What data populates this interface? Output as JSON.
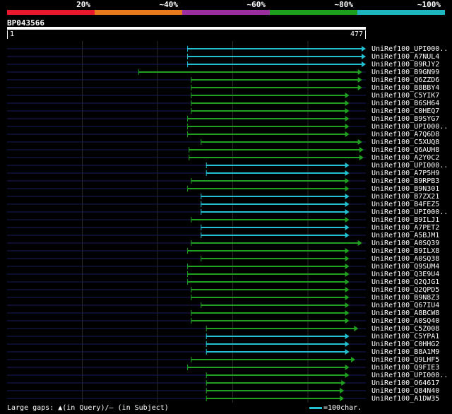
{
  "scale": {
    "segments": [
      {
        "label": "20%",
        "color": "#e8192c"
      },
      {
        "label": "~40%",
        "color": "#e87a1e"
      },
      {
        "label": "~60%",
        "color": "#9c2fa0"
      },
      {
        "label": "~80%",
        "color": "#1ea01e"
      },
      {
        "label": "~100%",
        "color": "#1eb4c0"
      }
    ]
  },
  "query": {
    "name": "BP043566",
    "start": "1",
    "end": "477",
    "length": 477
  },
  "colors": {
    "cyan": "#22c0d0",
    "green": "#20a020",
    "navy": "#1a1a60",
    "grid": "#2a2a2a"
  },
  "hits": [
    {
      "name": "UniRef100_UPI000..",
      "start": 240,
      "end": 477,
      "color": "cyan"
    },
    {
      "name": "UniRef100_A7NUL4",
      "start": 240,
      "end": 477,
      "color": "cyan"
    },
    {
      "name": "UniRef100_B9RJY2",
      "start": 240,
      "end": 477,
      "color": "cyan"
    },
    {
      "name": "UniRef100_B9GN99",
      "start": 175,
      "end": 472,
      "color": "green"
    },
    {
      "name": "UniRef100_Q6ZZD6",
      "start": 245,
      "end": 472,
      "color": "green"
    },
    {
      "name": "UniRef100_B8BBY4",
      "start": 245,
      "end": 472,
      "color": "green"
    },
    {
      "name": "UniRef100_C5YIK7",
      "start": 245,
      "end": 455,
      "color": "green"
    },
    {
      "name": "UniRef100_B6SH64",
      "start": 245,
      "end": 455,
      "color": "green"
    },
    {
      "name": "UniRef100_C0HEQ7",
      "start": 245,
      "end": 455,
      "color": "green"
    },
    {
      "name": "UniRef100_B9SYG7",
      "start": 240,
      "end": 455,
      "color": "green"
    },
    {
      "name": "UniRef100_UPI000..",
      "start": 240,
      "end": 455,
      "color": "green"
    },
    {
      "name": "UniRef100_A7Q6D8",
      "start": 240,
      "end": 455,
      "color": "green"
    },
    {
      "name": "UniRef100_C5XUQ8",
      "start": 258,
      "end": 472,
      "color": "green"
    },
    {
      "name": "UniRef100_Q6AUH8",
      "start": 242,
      "end": 474,
      "color": "green"
    },
    {
      "name": "UniRef100_A2Y0C2",
      "start": 242,
      "end": 474,
      "color": "green"
    },
    {
      "name": "UniRef100_UPI000..",
      "start": 265,
      "end": 455,
      "color": "cyan"
    },
    {
      "name": "UniRef100_A7P5H9",
      "start": 265,
      "end": 455,
      "color": "cyan"
    },
    {
      "name": "UniRef100_B9RPB3",
      "start": 245,
      "end": 455,
      "color": "green"
    },
    {
      "name": "UniRef100_B9N301",
      "start": 240,
      "end": 455,
      "color": "green"
    },
    {
      "name": "UniRef100_B7ZX21",
      "start": 258,
      "end": 455,
      "color": "cyan"
    },
    {
      "name": "UniRef100_B4FEZ5",
      "start": 258,
      "end": 455,
      "color": "cyan"
    },
    {
      "name": "UniRef100_UPI000..",
      "start": 258,
      "end": 455,
      "color": "cyan"
    },
    {
      "name": "UniRef100_B9ILJ1",
      "start": 245,
      "end": 455,
      "color": "green"
    },
    {
      "name": "UniRef100_A7PET2",
      "start": 258,
      "end": 455,
      "color": "cyan"
    },
    {
      "name": "UniRef100_A5BJM1",
      "start": 258,
      "end": 455,
      "color": "cyan"
    },
    {
      "name": "UniRef100_A0SQ39",
      "start": 245,
      "end": 472,
      "color": "green"
    },
    {
      "name": "UniRef100_B9ILX8",
      "start": 240,
      "end": 455,
      "color": "green"
    },
    {
      "name": "UniRef100_A0SQ38",
      "start": 258,
      "end": 455,
      "color": "green"
    },
    {
      "name": "UniRef100_Q9SUM4",
      "start": 240,
      "end": 455,
      "color": "green"
    },
    {
      "name": "UniRef100_Q3E9U4",
      "start": 240,
      "end": 455,
      "color": "green"
    },
    {
      "name": "UniRef100_Q2QJG1",
      "start": 240,
      "end": 455,
      "color": "green"
    },
    {
      "name": "UniRef100_Q2QPD5",
      "start": 245,
      "end": 455,
      "color": "green"
    },
    {
      "name": "UniRef100_B9N8Z3",
      "start": 245,
      "end": 455,
      "color": "green"
    },
    {
      "name": "UniRef100_Q67IU4",
      "start": 258,
      "end": 455,
      "color": "green"
    },
    {
      "name": "UniRef100_A8BCW8",
      "start": 245,
      "end": 455,
      "color": "green"
    },
    {
      "name": "UniRef100_A0SQ40",
      "start": 245,
      "end": 455,
      "color": "green"
    },
    {
      "name": "UniRef100_C5Z008",
      "start": 265,
      "end": 467,
      "color": "green"
    },
    {
      "name": "UniRef100_C5YPA1",
      "start": 265,
      "end": 455,
      "color": "cyan"
    },
    {
      "name": "UniRef100_C0HHG2",
      "start": 265,
      "end": 455,
      "color": "cyan"
    },
    {
      "name": "UniRef100_B8A1M9",
      "start": 265,
      "end": 455,
      "color": "cyan"
    },
    {
      "name": "UniRef100_Q9LHF5",
      "start": 245,
      "end": 463,
      "color": "green"
    },
    {
      "name": "UniRef100_Q9FIE3",
      "start": 240,
      "end": 455,
      "color": "green"
    },
    {
      "name": "UniRef100_UPI000..",
      "start": 265,
      "end": 455,
      "color": "green"
    },
    {
      "name": "UniRef100_O64617",
      "start": 265,
      "end": 450,
      "color": "green"
    },
    {
      "name": "UniRef100_Q84N40",
      "start": 265,
      "end": 448,
      "color": "green"
    },
    {
      "name": "UniRef100_A1DW35",
      "start": 265,
      "end": 448,
      "color": "green"
    }
  ],
  "legend": {
    "gaps": "Large gaps: ▲(in Query)/— (in Subject)",
    "scale": "=100char."
  }
}
